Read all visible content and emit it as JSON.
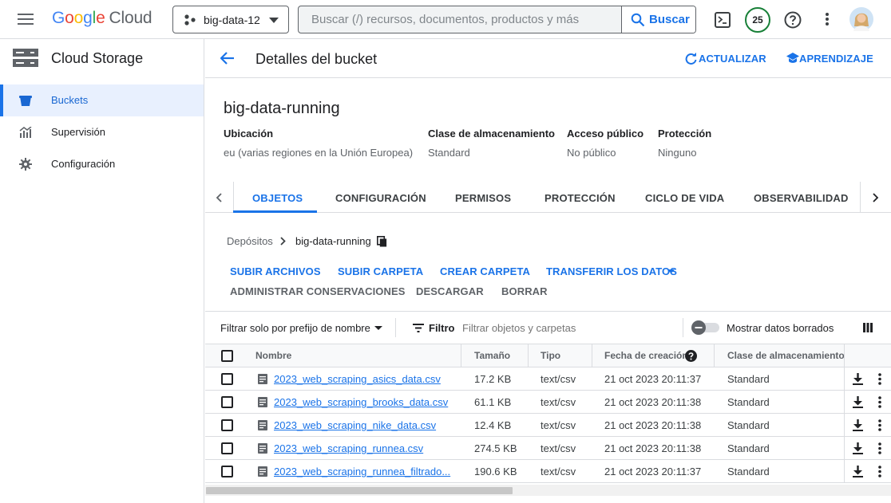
{
  "topbar": {
    "logo_google": "Google",
    "logo_cloud": "Cloud",
    "project": "big-data-12",
    "search_placeholder": "Buscar (/) recursos, documentos, productos y más",
    "search_button": "Buscar",
    "notifications_count": "25"
  },
  "sidenav": {
    "title": "Cloud Storage",
    "items": [
      {
        "label": "Buckets",
        "icon": "bucket-icon"
      },
      {
        "label": "Supervisión",
        "icon": "monitoring-icon"
      },
      {
        "label": "Configuración",
        "icon": "gear-icon"
      }
    ]
  },
  "header": {
    "title": "Detalles del bucket",
    "refresh": "ACTUALIZAR",
    "learn": "APRENDIZAJE"
  },
  "bucket": {
    "name": "big-data-running",
    "info": [
      {
        "label": "Ubicación",
        "value": "eu (varias regiones en la Unión Europea)"
      },
      {
        "label": "Clase de almacenamiento",
        "value": "Standard"
      },
      {
        "label": "Acceso público",
        "value": "No público"
      },
      {
        "label": "Protección",
        "value": "Ninguno"
      }
    ]
  },
  "tabs": [
    "OBJETOS",
    "CONFIGURACIÓN",
    "PERMISOS",
    "PROTECCIÓN",
    "CICLO DE VIDA",
    "OBSERVABILIDAD"
  ],
  "breadcrumb": {
    "root": "Depósitos",
    "current": "big-data-running"
  },
  "actions": {
    "upload_files": "SUBIR ARCHIVOS",
    "upload_folder": "SUBIR CARPETA",
    "create_folder": "CREAR CARPETA",
    "transfer": "TRANSFERIR LOS DATOS",
    "manage_holds": "ADMINISTRAR CONSERVACIONES",
    "download": "DESCARGAR",
    "delete": "BORRAR"
  },
  "filter": {
    "prefix": "Filtrar solo por prefijo de nombre",
    "filter_label": "Filtro",
    "placeholder": "Filtrar objetos y carpetas",
    "show_deleted": "Mostrar datos borrados"
  },
  "table": {
    "columns": [
      "Nombre",
      "Tamaño",
      "Tipo",
      "Fecha de creación",
      "Clase de almacenamiento"
    ],
    "rows": [
      {
        "name": "2023_web_scraping_asics_data.csv",
        "size": "17.2 KB",
        "type": "text/csv",
        "created": "21 oct 2023 20:11:37",
        "class": "Standard"
      },
      {
        "name": "2023_web_scraping_brooks_data.csv",
        "size": "61.1 KB",
        "type": "text/csv",
        "created": "21 oct 2023 20:11:38",
        "class": "Standard"
      },
      {
        "name": "2023_web_scraping_nike_data.csv",
        "size": "12.4 KB",
        "type": "text/csv",
        "created": "21 oct 2023 20:11:38",
        "class": "Standard"
      },
      {
        "name": "2023_web_scraping_runnea.csv",
        "size": "274.5 KB",
        "type": "text/csv",
        "created": "21 oct 2023 20:11:38",
        "class": "Standard"
      },
      {
        "name": "2023_web_scraping_runnea_filtrado...",
        "size": "190.6 KB",
        "type": "text/csv",
        "created": "21 oct 2023 20:11:37",
        "class": "Standard"
      }
    ]
  }
}
